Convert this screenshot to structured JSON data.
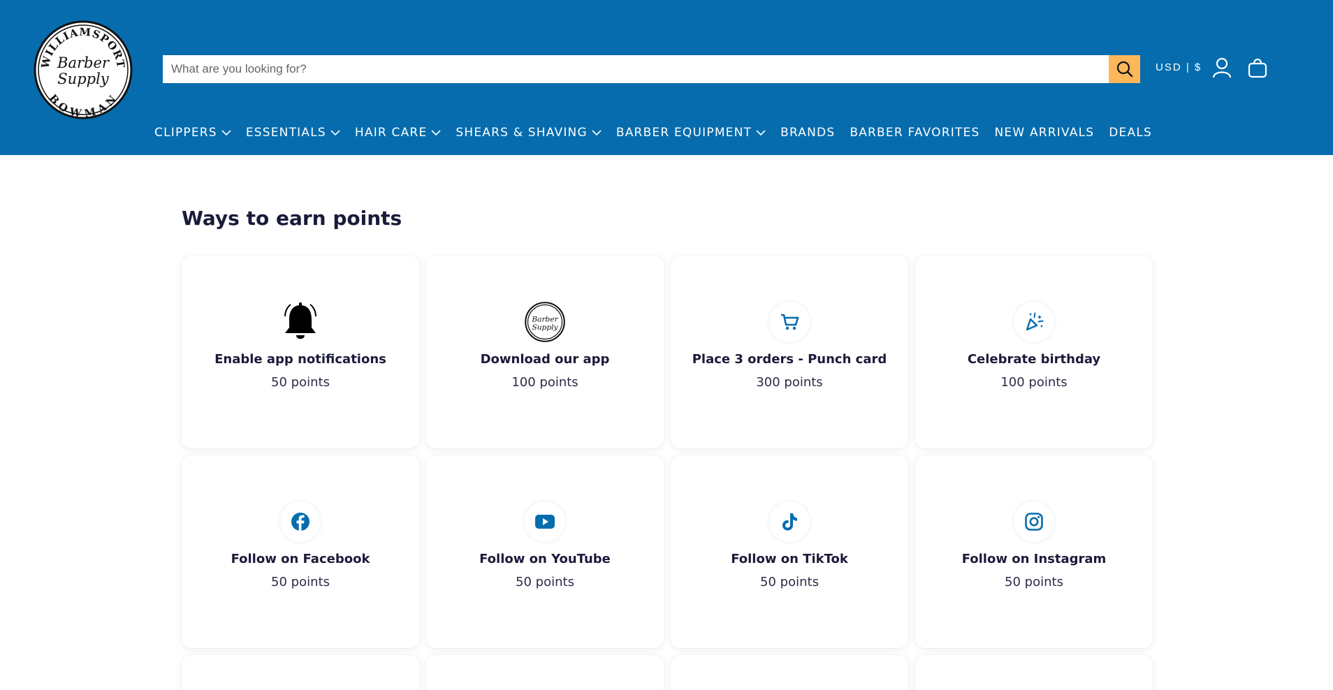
{
  "header": {
    "logo_text": [
      "WILLIAMSPORT",
      "Barber",
      "Supply",
      "BOWMAN"
    ],
    "search_placeholder": "What are you looking for?",
    "currency": "USD | $",
    "colors": {
      "header_bg": "#066cad",
      "search_button": "#fcb75a"
    }
  },
  "nav": {
    "items": [
      {
        "label": "CLIPPERS",
        "has_dropdown": true
      },
      {
        "label": "ESSENTIALS",
        "has_dropdown": true
      },
      {
        "label": "HAIR CARE",
        "has_dropdown": true
      },
      {
        "label": "SHEARS & SHAVING",
        "has_dropdown": true
      },
      {
        "label": "BARBER EQUIPMENT",
        "has_dropdown": true
      },
      {
        "label": "BRANDS",
        "has_dropdown": false
      },
      {
        "label": "BARBER FAVORITES",
        "has_dropdown": false
      },
      {
        "label": "NEW ARRIVALS",
        "has_dropdown": false
      },
      {
        "label": "DEALS",
        "has_dropdown": false
      }
    ]
  },
  "main": {
    "title": "Ways to earn points",
    "cards": [
      {
        "icon": "bell-icon",
        "title": "Enable app notifications",
        "points": "50 points"
      },
      {
        "icon": "logo-badge-icon",
        "title": "Download our app",
        "points": "100 points"
      },
      {
        "icon": "cart-icon",
        "title": "Place 3 orders - Punch card",
        "points": "300 points"
      },
      {
        "icon": "party-popper-icon",
        "title": "Celebrate birthday",
        "points": "100 points"
      },
      {
        "icon": "facebook-icon",
        "title": "Follow on Facebook",
        "points": "50 points"
      },
      {
        "icon": "youtube-icon",
        "title": "Follow on YouTube",
        "points": "50 points"
      },
      {
        "icon": "tiktok-icon",
        "title": "Follow on TikTok",
        "points": "50 points"
      },
      {
        "icon": "instagram-icon",
        "title": "Follow on Instagram",
        "points": "50 points"
      }
    ],
    "accent_color": "#066cad"
  }
}
